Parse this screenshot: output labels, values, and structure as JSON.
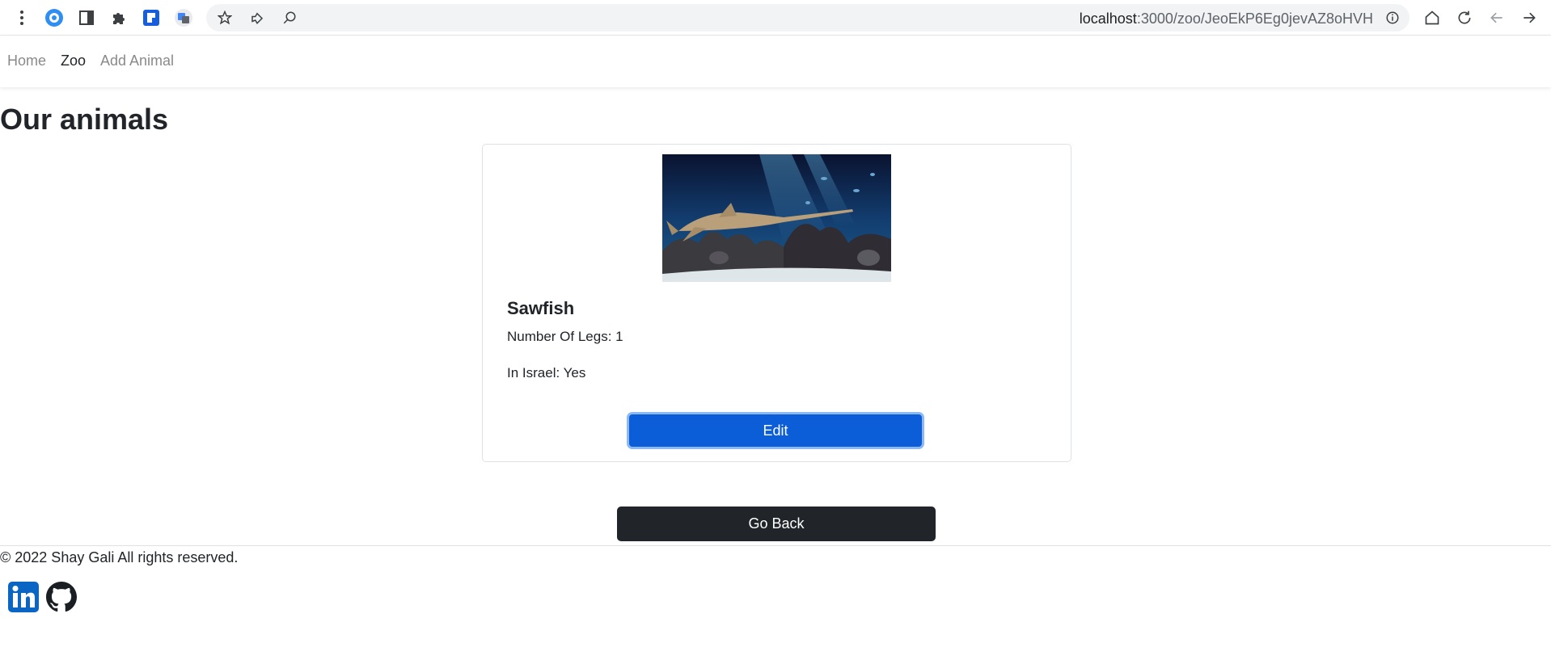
{
  "browser": {
    "url_host": "localhost",
    "url_path": ":3000/zoo/JeoEkP6Eg0jevAZ8oHVH"
  },
  "nav": {
    "home": "Home",
    "zoo": "Zoo",
    "add_animal": "Add Animal"
  },
  "page": {
    "title": "Our animals"
  },
  "animal": {
    "name": "Sawfish",
    "legs": "Number Of Legs: 1",
    "in_israel": "In Israel: Yes",
    "edit_label": "Edit"
  },
  "actions": {
    "go_back_label": "Go Back"
  },
  "footer": {
    "copyright": "© 2022 Shay Gali All rights reserved.",
    "social": [
      "linkedin-icon",
      "github-icon"
    ]
  },
  "colors": {
    "primary": "#0b5ed7",
    "dark": "#212529",
    "linkedin": "#0a66c2"
  }
}
